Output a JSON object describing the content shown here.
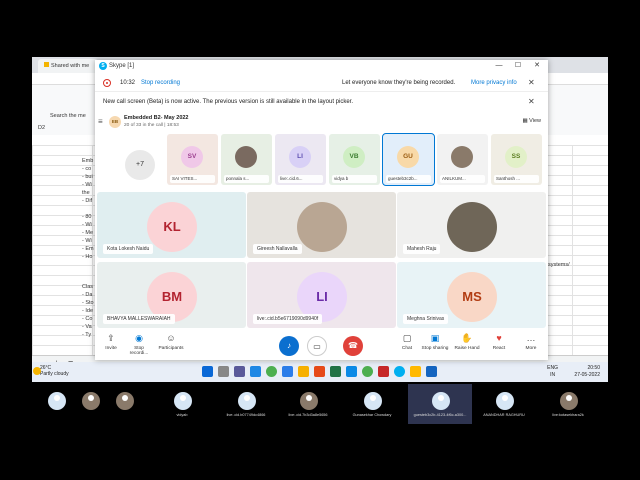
{
  "browser": {
    "tab1": "Shared with me",
    "cell_ref": "D2",
    "search_menu": "Search the me",
    "sheet_lines": [
      "Emb",
      "- co",
      "- bui",
      "- Wi",
      "the",
      "- Dif",
      "- 80",
      "- Wi",
      "- Me",
      "- Wi",
      "- Em",
      "- Ho",
      "Clas",
      "- Da",
      "- Sto",
      "- Ide",
      "- Co",
      "- Va",
      "- Ty"
    ],
    "sheet_right": "ed-systems/"
  },
  "skype": {
    "window_title": "Skype [1]",
    "minimize": "—",
    "maximize": "☐",
    "close": "✕",
    "recording": {
      "time": "10:32",
      "stop_label": "Stop recording",
      "message": "Let everyone know they're being recorded.",
      "privacy_link": "More privacy info"
    },
    "notice": "New call screen (Beta) is now active. The previous version is still available in the layout picker.",
    "call": {
      "group_initials": "EB",
      "title": "Embedded B2- May 2022",
      "subtitle": "20 of 33 in the call | 18:53",
      "view_label": "View"
    },
    "more_count": "+7",
    "strip": [
      {
        "initials": "SV",
        "name": "SAI VITES...",
        "bg": "#f3e7e1",
        "av": "#f0c8e8",
        "fg": "#9b3f8f"
      },
      {
        "initials": "",
        "name": "ponnala s...",
        "bg": "#e7efe4",
        "av": "#7a6a60",
        "fg": "#fff"
      },
      {
        "initials": "LI",
        "name": "live:.cid.6...",
        "bg": "#ece8f2",
        "av": "#d8d0f6",
        "fg": "#5b4cb0"
      },
      {
        "initials": "VB",
        "name": "vidya b",
        "bg": "#e6f0e6",
        "av": "#cfeec3",
        "fg": "#3c7d2f"
      },
      {
        "initials": "GU",
        "name": "guesteb3c2b...",
        "bg": "#e2eefa",
        "av": "#f8d9a8",
        "fg": "#9a5b10"
      },
      {
        "initials": "",
        "name": "ANILKUM...",
        "bg": "#f2f2f2",
        "av": "#8a7a6a",
        "fg": "#fff"
      },
      {
        "initials": "SS",
        "name": "Santhosh ...",
        "bg": "#f0ede4",
        "av": "#e2f0c8",
        "fg": "#5b7d20"
      }
    ],
    "tiles": [
      {
        "initials": "KL",
        "name": "Kota Lokesh Naidu",
        "bg": "#e0eef0",
        "av": "#fbd3d6",
        "fg": "#b32330"
      },
      {
        "initials": "",
        "name": "Gireesh Nallavalla",
        "bg": "#e6e3de",
        "av": "#b9a693",
        "fg": "#fff"
      },
      {
        "initials": "",
        "name": "Mahesh Raju",
        "bg": "#f0f0ef",
        "av": "#6f6658",
        "fg": "#fff"
      },
      {
        "initials": "BM",
        "name": "BHAVYA MALLESWARAIAH",
        "bg": "#e9efee",
        "av": "#fbd3d6",
        "fg": "#b32330"
      },
      {
        "initials": "LI",
        "name": "live:.cid.b5e6719090d9940f",
        "bg": "#efe6ec",
        "av": "#ead6fa",
        "fg": "#6b2ca8"
      },
      {
        "initials": "MS",
        "name": "Meghna Srinivas",
        "bg": "#e8f3f6",
        "av": "#f9d7c6",
        "fg": "#b23c12"
      }
    ],
    "controls": {
      "invite": "Invite",
      "stop_rec": "Stop recordi...",
      "participants": "Participants",
      "chat": "Chat",
      "stop_sharing": "Stop sharing",
      "raise_hand": "Raise Hand",
      "react": "React",
      "more": "More"
    }
  },
  "taskbar": {
    "temp": "26°C",
    "weather": "Partly cloudy",
    "lang1": "ENG",
    "lang2": "IN",
    "time": "20:50",
    "date": "27-05-2022"
  },
  "bottom_row": {
    "more_count": "+9",
    "names": [
      "",
      "",
      "",
      "vidyab",
      "live:.cid.b07749dc4866",
      "live:.cid.7b3d3a8e5656",
      "Gunasekhar Chowdary",
      "guesteb3c2b-4123-4f6c-a300...",
      "ANANDHAR RAGHURU",
      "live:kotasekhara2k"
    ]
  },
  "colors": {
    "accent": "#0078d4",
    "end_call": "#e0413a",
    "mic_active": "#0b6fcf"
  }
}
